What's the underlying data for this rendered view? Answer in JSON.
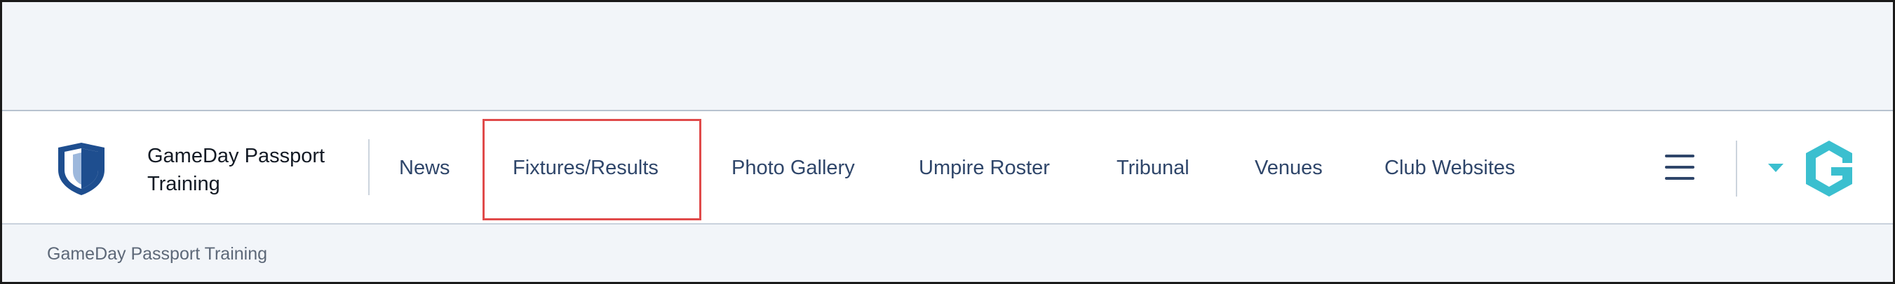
{
  "org": {
    "name": "GameDay Passport Training",
    "logo_icon": "shield-logo-icon"
  },
  "nav": {
    "items": [
      {
        "label": "News"
      },
      {
        "label": "Fixtures/Results"
      },
      {
        "label": "Photo Gallery"
      },
      {
        "label": "Umpire Roster"
      },
      {
        "label": "Tribunal"
      },
      {
        "label": "Venues"
      },
      {
        "label": "Club Websites"
      }
    ],
    "highlighted": "Fixtures/Results",
    "highlight_color": "#e04a4a",
    "text_color": "#2f466a"
  },
  "toolbar": {
    "menu_icon": "hamburger-menu-icon",
    "dropdown_icon": "caret-down-icon",
    "brand_icon": "gameday-logo-icon",
    "accent_color": "#3bbfcf"
  },
  "breadcrumb": {
    "text": "GameDay Passport Training"
  }
}
